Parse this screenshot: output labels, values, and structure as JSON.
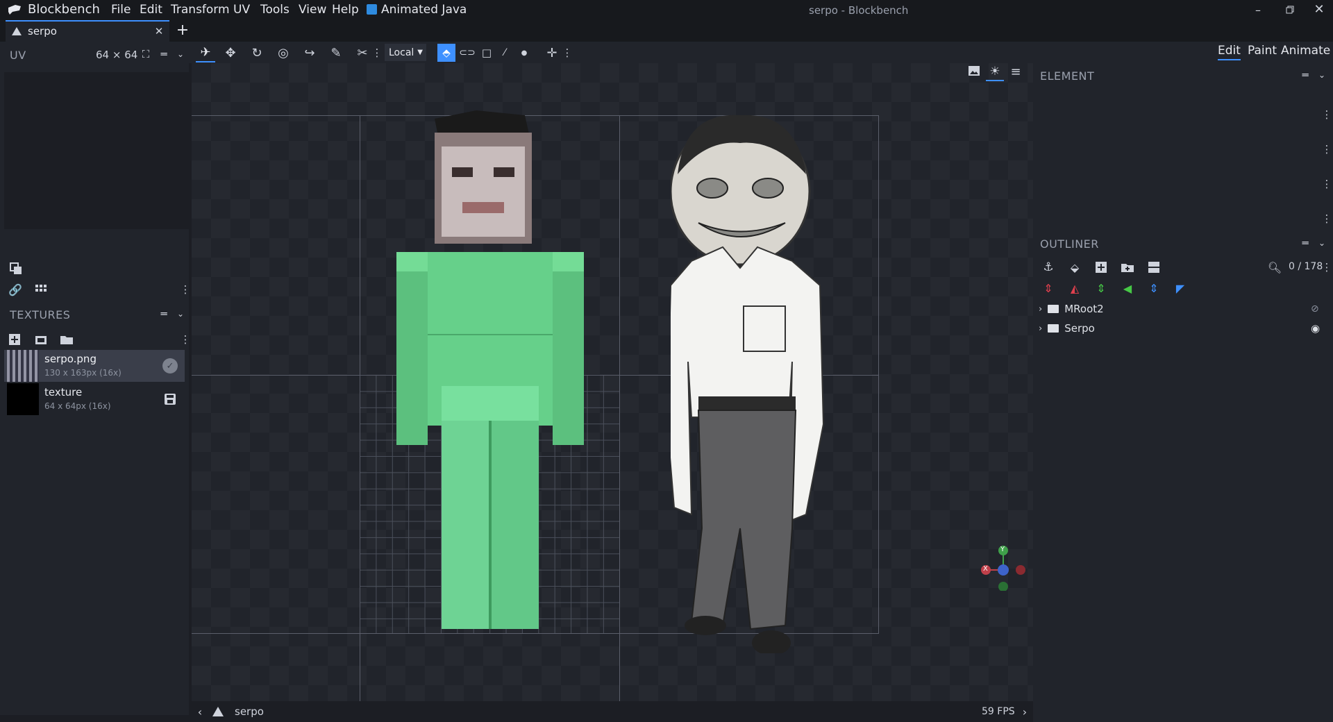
{
  "titlebar": {
    "app_name": "Blockbench",
    "menus": [
      "File",
      "Edit",
      "Transform",
      "UV",
      "Tools",
      "View",
      "Help"
    ],
    "plugin_label": "Animated Java",
    "window_title": "serpo - Blockbench"
  },
  "tabs": [
    {
      "label": "serpo"
    }
  ],
  "uv_panel": {
    "title": "UV",
    "size_label": "64 × 64"
  },
  "toolbar": {
    "space_select": "Local"
  },
  "modes": [
    "Edit",
    "Paint",
    "Animate"
  ],
  "textures": {
    "title": "TEXTURES",
    "items": [
      {
        "name": "serpo.png",
        "meta": "130 x 163px (16x)"
      },
      {
        "name": "texture",
        "meta": "64 x 64px (16x)"
      }
    ]
  },
  "element_panel": {
    "title": "ELEMENT"
  },
  "outliner": {
    "title": "OUTLINER",
    "count": "0 / 178",
    "groups": [
      {
        "name": "MRoot2"
      },
      {
        "name": "Serpo"
      }
    ]
  },
  "gizmo": {
    "y": "Y",
    "x": "X"
  },
  "statusbar": {
    "project": "serpo",
    "fps": "59 FPS"
  },
  "colors": {
    "accent": "#3e90ff",
    "bg": "#21242b",
    "model_green": "#66d08a"
  }
}
